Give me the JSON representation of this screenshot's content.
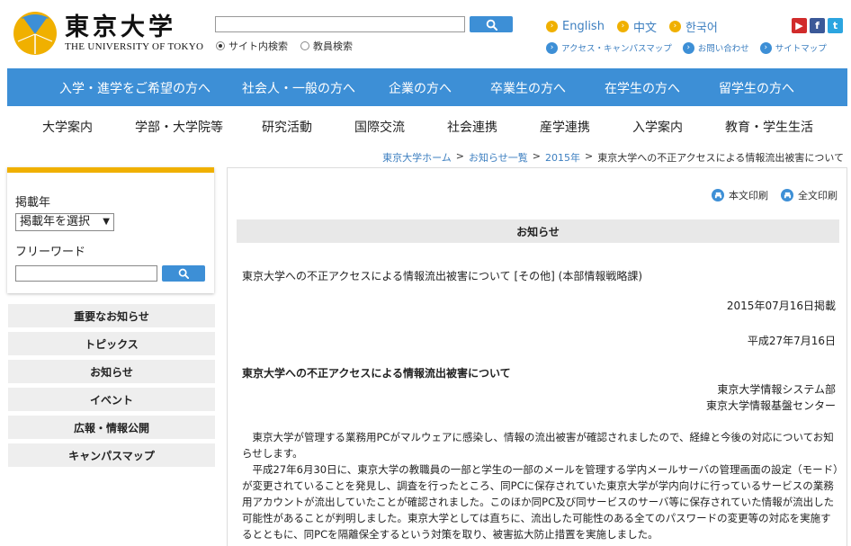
{
  "header": {
    "logo_jp": "東京大学",
    "logo_en": "THE UNIVERSITY OF TOKYO",
    "search": {
      "value": "",
      "button_icon": "search-icon"
    },
    "radio": [
      {
        "label": "サイト内検索",
        "selected": true
      },
      {
        "label": "教員検索",
        "selected": false
      }
    ],
    "languages": [
      {
        "label": "English"
      },
      {
        "label": "中文"
      },
      {
        "label": "한국어"
      }
    ],
    "utility_links": [
      {
        "label": "アクセス・キャンパスマップ"
      },
      {
        "label": "お問い合わせ"
      },
      {
        "label": "サイトマップ"
      }
    ],
    "social": [
      {
        "name": "youtube-icon",
        "glyph": "▶"
      },
      {
        "name": "facebook-icon",
        "glyph": "f"
      },
      {
        "name": "twitter-icon",
        "glyph": "t"
      }
    ]
  },
  "main_nav": [
    "入学・進学をご希望の方へ",
    "社会人・一般の方へ",
    "企業の方へ",
    "卒業生の方へ",
    "在学生の方へ",
    "留学生の方へ"
  ],
  "sub_nav": [
    "大学案内",
    "学部・大学院等",
    "研究活動",
    "国際交流",
    "社会連携",
    "産学連携",
    "入学案内",
    "教育・学生生活"
  ],
  "breadcrumb": {
    "items": [
      "東京大学ホーム",
      "お知らせ一覧",
      "2015年"
    ],
    "current": "東京大学への不正アクセスによる情報流出被害について",
    "separator": ">"
  },
  "sidebar": {
    "year_label": "掲載年",
    "year_select": "掲載年を選択",
    "freeword_label": "フリーワード",
    "freeword_value": "",
    "menu": [
      "重要なお知らせ",
      "トピックス",
      "お知らせ",
      "イベント",
      "広報・情報公開",
      "キャンパスマップ"
    ]
  },
  "article": {
    "print_body": "本文印刷",
    "print_all": "全文印刷",
    "section_label": "お知らせ",
    "title_line": "東京大学への不正アクセスによる情報流出被害について [その他] (本部情報戦略課)",
    "posted_date": "2015年07月16日掲載",
    "heisei_date": "平成27年7月16日",
    "heading": "東京大学への不正アクセスによる情報流出被害について",
    "org1": "東京大学情報システム部",
    "org2": "東京大学情報基盤センター",
    "paragraph1": "東京大学が管理する業務用PCがマルウェアに感染し、情報の流出被害が確認されましたので、経緯と今後の対応についてお知らせします。",
    "paragraph2": "平成27年6月30日に、東京大学の教職員の一部と学生の一部のメールを管理する学内メールサーバの管理画面の設定（モード）が変更されていることを発見し、調査を行ったところ、同PCに保存されていた東京大学が学内向けに行っているサービスの業務用アカウントが流出していたことが確認されました。このほか同PC及び同サービスのサーバ等に保存されていた情報が流出した可能性があることが判明しました。東京大学としては直ちに、流出した可能性のある全てのパスワードの変更等の対応を実施するとともに、同PCを隔離保全するという対策を取り、被害拡大防止措置を実施しました。"
  },
  "colors": {
    "brand_blue": "#3d8fd6",
    "accent_yellow": "#f0b000",
    "link_blue": "#3d7fc0"
  }
}
